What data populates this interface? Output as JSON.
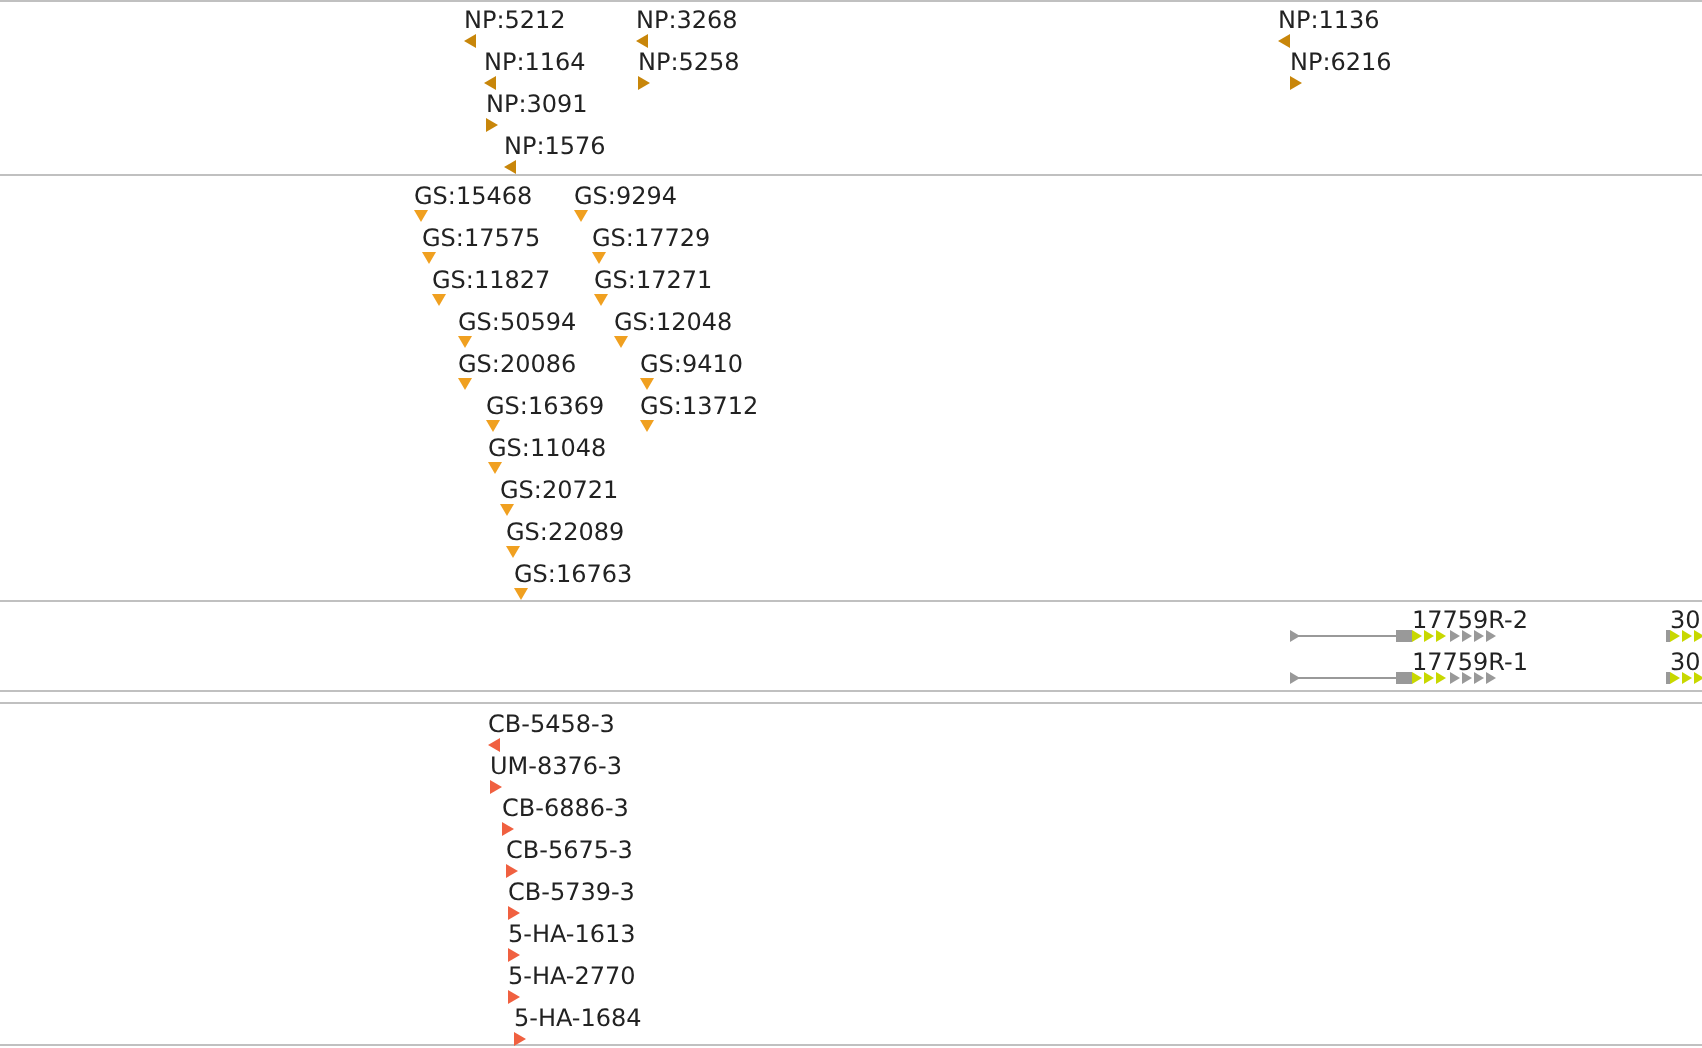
{
  "tracks": [
    {
      "color": "#c8860a",
      "features": [
        {
          "label": "NP:5212",
          "kind": "left"
        },
        {
          "label": "NP:3268",
          "kind": "left"
        },
        {
          "label": "NP:1136",
          "kind": "left"
        },
        {
          "label": "NP:1164",
          "kind": "left"
        },
        {
          "label": "NP:5258",
          "kind": "right"
        },
        {
          "label": "NP:6216",
          "kind": "right"
        },
        {
          "label": "NP:3091",
          "kind": "right"
        },
        {
          "label": "NP:1576",
          "kind": "left"
        }
      ]
    },
    {
      "color": "#f0a020",
      "features": [
        {
          "label": "GS:15468",
          "kind": "down"
        },
        {
          "label": "GS:9294",
          "kind": "down"
        },
        {
          "label": "GS:17575",
          "kind": "down"
        },
        {
          "label": "GS:17729",
          "kind": "down"
        },
        {
          "label": "GS:11827",
          "kind": "down"
        },
        {
          "label": "GS:17271",
          "kind": "down"
        },
        {
          "label": "GS:50594",
          "kind": "down"
        },
        {
          "label": "GS:12048",
          "kind": "down"
        },
        {
          "label": "GS:20086",
          "kind": "down"
        },
        {
          "label": "GS:9410",
          "kind": "down"
        },
        {
          "label": "GS:16369",
          "kind": "down"
        },
        {
          "label": "GS:13712",
          "kind": "down"
        },
        {
          "label": "GS:11048",
          "kind": "down"
        },
        {
          "label": "GS:20721",
          "kind": "down"
        },
        {
          "label": "GS:22089",
          "kind": "down"
        },
        {
          "label": "GS:16763",
          "kind": "down"
        }
      ]
    },
    {
      "color": "#c8d800",
      "features": [
        {
          "label": "17759R-2",
          "kind": "transcript"
        },
        {
          "label": "30",
          "kind": "partial"
        },
        {
          "label": "17759R-1",
          "kind": "transcript"
        },
        {
          "label": "30",
          "kind": "partial"
        }
      ]
    },
    {
      "color": "#f06040",
      "features": [
        {
          "label": "CB-5458-3",
          "kind": "left"
        },
        {
          "label": "UM-8376-3",
          "kind": "right"
        },
        {
          "label": "CB-6886-3",
          "kind": "right"
        },
        {
          "label": "CB-5675-3",
          "kind": "right"
        },
        {
          "label": "CB-5739-3",
          "kind": "right"
        },
        {
          "label": "5-HA-1613",
          "kind": "right"
        },
        {
          "label": "5-HA-2770",
          "kind": "right"
        },
        {
          "label": "5-HA-1684",
          "kind": "right"
        }
      ]
    }
  ]
}
